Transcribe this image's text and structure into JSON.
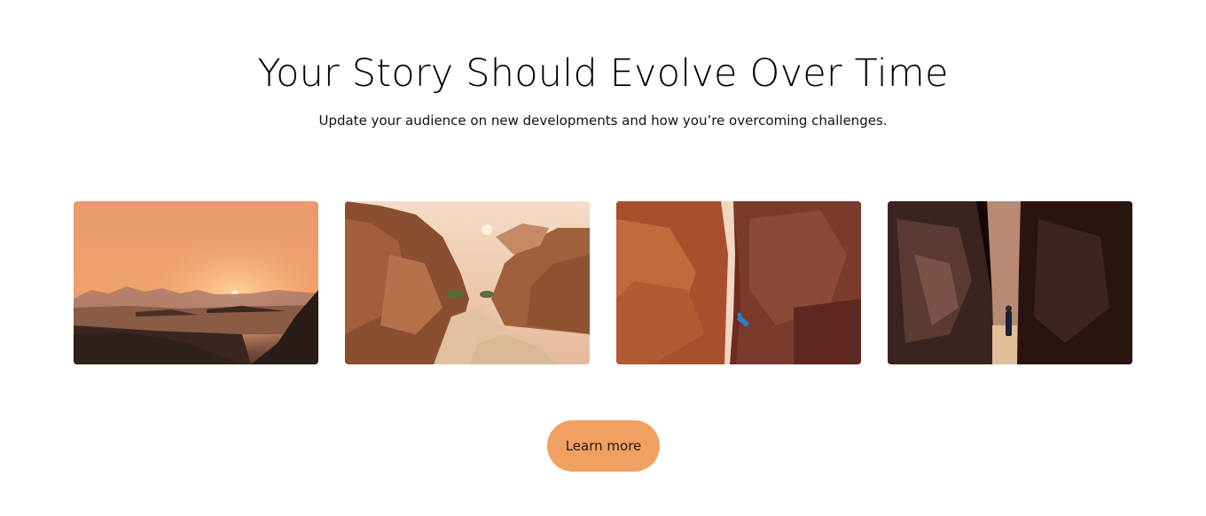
{
  "header": {
    "title": "Your Story Should Evolve Over Time",
    "subtitle": "Update your audience on new developments and how you’re overcoming challenges."
  },
  "gallery": {
    "images": [
      {
        "name": "desert-sunset-image"
      },
      {
        "name": "rocky-canyon-valley-image"
      },
      {
        "name": "red-slot-canyon-climber-image"
      },
      {
        "name": "dark-narrow-canyon-hiker-image"
      }
    ]
  },
  "cta": {
    "label": "Learn more",
    "color": "#F0A060"
  }
}
